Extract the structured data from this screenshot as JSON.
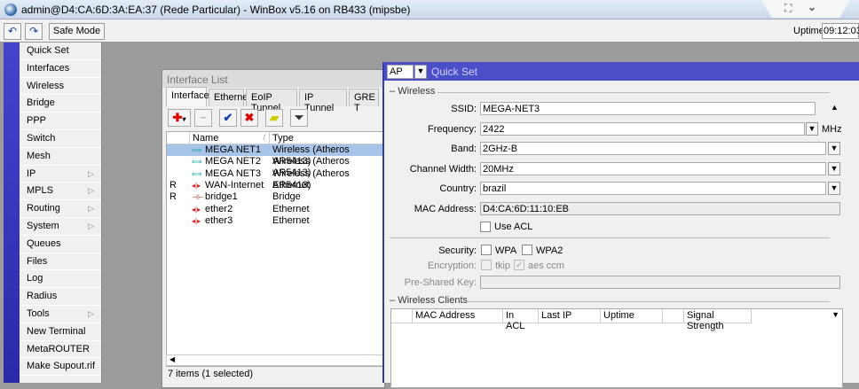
{
  "window": {
    "title": "admin@D4:CA:6D:3A:EA:37 (Rede Particular) - WinBox v5.16 on RB433 (mipsbe)",
    "controls": [
      "expand-icon",
      "chevron-down-icon"
    ]
  },
  "toolbar": {
    "undo_icon": "undo-icon",
    "redo_icon": "redo-icon",
    "safe_mode": "Safe Mode",
    "uptime_label": "Uptime:",
    "uptime_value": "09:12:03"
  },
  "menu": {
    "items": [
      {
        "label": "Quick Set",
        "submenu": false
      },
      {
        "label": "Interfaces",
        "submenu": false
      },
      {
        "label": "Wireless",
        "submenu": false
      },
      {
        "label": "Bridge",
        "submenu": false
      },
      {
        "label": "PPP",
        "submenu": false
      },
      {
        "label": "Switch",
        "submenu": false
      },
      {
        "label": "Mesh",
        "submenu": false
      },
      {
        "label": "IP",
        "submenu": true
      },
      {
        "label": "MPLS",
        "submenu": true
      },
      {
        "label": "Routing",
        "submenu": true
      },
      {
        "label": "System",
        "submenu": true
      },
      {
        "label": "Queues",
        "submenu": false
      },
      {
        "label": "Files",
        "submenu": false
      },
      {
        "label": "Log",
        "submenu": false
      },
      {
        "label": "Radius",
        "submenu": false
      },
      {
        "label": "Tools",
        "submenu": true
      },
      {
        "label": "New Terminal",
        "submenu": false
      },
      {
        "label": "MetaROUTER",
        "submenu": false
      },
      {
        "label": "Make Supout.rif",
        "submenu": false
      }
    ]
  },
  "interface_list": {
    "title": "Interface List",
    "tabs": [
      "Interface",
      "Ethernet",
      "EoIP Tunnel",
      "IP Tunnel",
      "GRE T"
    ],
    "active_tab": "Interface",
    "columns": [
      "",
      "Name",
      "Type"
    ],
    "rows": [
      {
        "flag": "",
        "name": "MEGA NET1",
        "type": "Wireless (Atheros AR5413)",
        "icon": "wireless",
        "selected": true
      },
      {
        "flag": "",
        "name": "MEGA NET2",
        "type": "Wireless (Atheros AR5413)",
        "icon": "wireless",
        "selected": false
      },
      {
        "flag": "",
        "name": "MEGA NET3",
        "type": "Wireless (Atheros AR5413)",
        "icon": "wireless",
        "selected": false
      },
      {
        "flag": "R",
        "name": "WAN-Internet",
        "type": "Ethernet",
        "icon": "ethernet",
        "selected": false
      },
      {
        "flag": "R",
        "name": "bridge1",
        "type": "Bridge",
        "icon": "bridge",
        "selected": false
      },
      {
        "flag": "",
        "name": "ether2",
        "type": "Ethernet",
        "icon": "ethernet",
        "selected": false
      },
      {
        "flag": "",
        "name": "ether3",
        "type": "Ethernet",
        "icon": "ethernet",
        "selected": false
      }
    ],
    "status": "7 items (1 selected)"
  },
  "quick_set": {
    "mode": "AP",
    "title": "Quick Set",
    "wireless_section": "Wireless",
    "ssid_label": "SSID:",
    "ssid": "MEGA-NET3",
    "frequency_label": "Frequency:",
    "frequency": "2422",
    "frequency_unit": "MHz",
    "band_label": "Band:",
    "band": "2GHz-B",
    "channel_width_label": "Channel Width:",
    "channel_width": "20MHz",
    "country_label": "Country:",
    "country": "brazil",
    "mac_label": "MAC Address:",
    "mac": "D4:CA:6D:11:10:EB",
    "use_acl": "Use ACL",
    "use_acl_checked": false,
    "security_label": "Security:",
    "wpa": "WPA",
    "wpa_checked": false,
    "wpa2": "WPA2",
    "wpa2_checked": false,
    "encryption_label": "Encryption:",
    "tkip": "tkip",
    "tkip_checked": false,
    "aes": "aes ccm",
    "aes_checked": true,
    "psk_label": "Pre-Shared Key:",
    "psk": "",
    "clients_section": "Wireless Clients",
    "client_columns": [
      "",
      "MAC Address",
      "In ACL",
      "Last IP",
      "Uptime",
      "",
      "Signal Strength"
    ]
  },
  "colors": {
    "accent": "#4a4fc8",
    "selection": "#a7c3e8",
    "desktop": "#9c9c9c"
  }
}
